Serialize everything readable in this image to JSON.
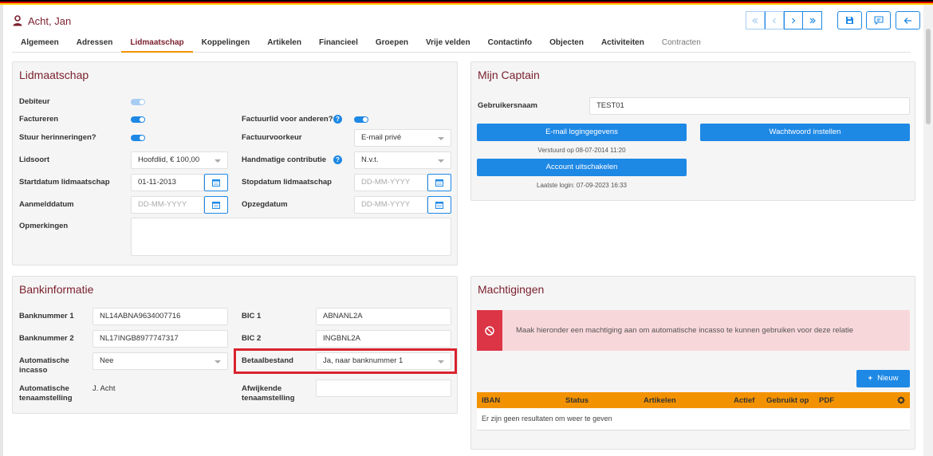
{
  "colors": {
    "accent": "#1e88e5",
    "title": "#7a1f2c",
    "tab_underline": "#f39200",
    "flag": [
      "#000000",
      "#dd0000",
      "#ffce00"
    ]
  },
  "header": {
    "title": "Acht, Jan",
    "icon": "user-icon"
  },
  "tabs": [
    {
      "label": "Algemeen"
    },
    {
      "label": "Adressen"
    },
    {
      "label": "Lidmaatschap",
      "active": true
    },
    {
      "label": "Koppelingen"
    },
    {
      "label": "Artikelen"
    },
    {
      "label": "Financieel"
    },
    {
      "label": "Groepen"
    },
    {
      "label": "Vrije velden"
    },
    {
      "label": "Contactinfo"
    },
    {
      "label": "Objecten"
    },
    {
      "label": "Activiteiten"
    },
    {
      "label": "Contracten"
    }
  ],
  "lidmaatschap": {
    "title": "Lidmaatschap",
    "debiteur": {
      "label": "Debiteur",
      "on": true
    },
    "factureren": {
      "label": "Factureren",
      "on": true
    },
    "herinneringen": {
      "label": "Stuur herinneringen?",
      "on": true
    },
    "factuurlid": {
      "label": "Factuurlid voor anderen?",
      "on": true
    },
    "factuurvoorkeur": {
      "label": "Factuurvoorkeur",
      "value": "E-mail privé"
    },
    "lidsoort": {
      "label": "Lidsoort",
      "value": "Hoofdlid, € 100,00"
    },
    "contributie": {
      "label": "Handmatige contributie",
      "value": "N.v.t."
    },
    "startdatum": {
      "label": "Startdatum lidmaatschap",
      "value": "01-11-2013"
    },
    "stopdatum": {
      "label": "Stopdatum lidmaatschap",
      "placeholder": "DD-MM-YYYY"
    },
    "aanmelddatum": {
      "label": "Aanmelddatum",
      "placeholder": "DD-MM-YYYY"
    },
    "opzegdatum": {
      "label": "Opzegdatum",
      "placeholder": "DD-MM-YYYY"
    },
    "opmerkingen": {
      "label": "Opmerkingen",
      "value": ""
    }
  },
  "captain": {
    "title": "Mijn Captain",
    "gebruikersnaam": {
      "label": "Gebruikersnaam",
      "value": "TEST01"
    },
    "email_btn": "E-mail logingegevens",
    "wachtwoord_btn": "Wachtwoord instellen",
    "verstuurd": "Verstuurd op 08-07-2014 11:20",
    "uitschakelen_btn": "Account uitschakelen",
    "laatste_login": "Laatste login: 07-09-2023 16:33"
  },
  "bank": {
    "title": "Bankinformatie",
    "bank1": {
      "label": "Banknummer 1",
      "value": "NL14ABNA9634007716"
    },
    "bank2": {
      "label": "Banknummer 2",
      "value": "NL17INGB8977747317"
    },
    "bic1": {
      "label": "BIC 1",
      "value": "ABNANL2A"
    },
    "bic2": {
      "label": "BIC 2",
      "value": "INGBNL2A"
    },
    "incasso": {
      "label1": "Automatische",
      "label2": "incasso",
      "value": "Nee"
    },
    "betaalbestand": {
      "label": "Betaalbestand",
      "value": "Ja, naar banknummer 1"
    },
    "tenaamstelling": {
      "label1": "Automatische",
      "label2": "tenaamstelling",
      "value": "J. Acht"
    },
    "afwijkend": {
      "label1": "Afwijkende",
      "label2": "tenaamstelling",
      "value": ""
    }
  },
  "machtigingen": {
    "title": "Machtigingen",
    "alert": "Maak hieronder een machtiging aan om automatische incasso te kunnen gebruiken voor deze relatie",
    "new_btn": "Nieuw",
    "columns": [
      "IBAN",
      "Status",
      "Artikelen",
      "Actief",
      "Gebruikt op",
      "PDF"
    ],
    "empty": "Er zijn geen resultaten om weer te geven"
  }
}
